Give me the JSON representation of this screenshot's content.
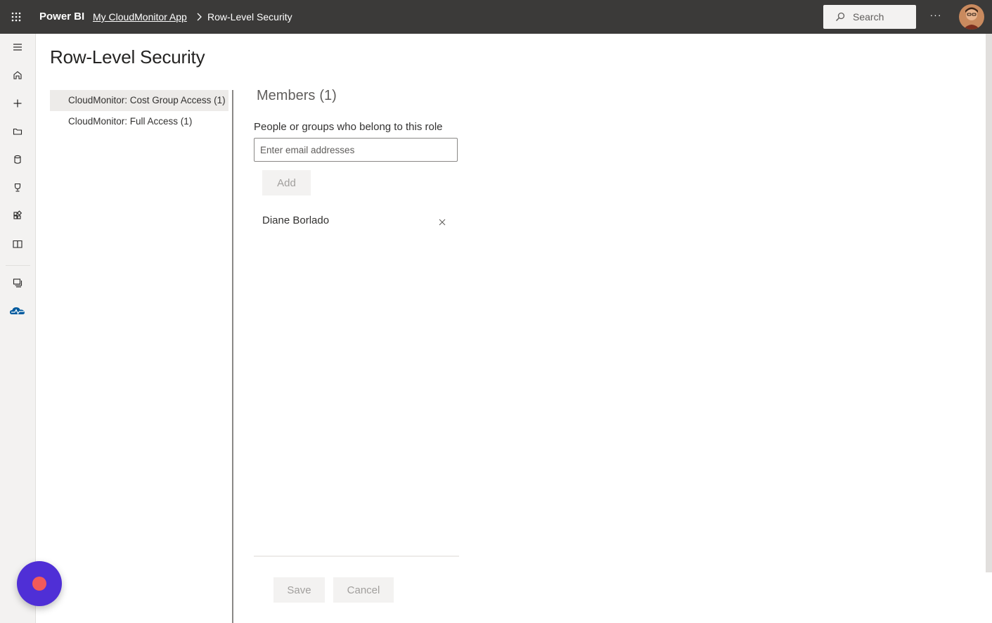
{
  "topbar": {
    "brand": "Power BI",
    "breadcrumb": {
      "app": "My CloudMonitor App",
      "current": "Row-Level Security"
    },
    "search_placeholder": "Search",
    "more_label": "···"
  },
  "rail": {
    "items": [
      {
        "name": "hamburger-icon"
      },
      {
        "name": "home-icon"
      },
      {
        "name": "plus-icon"
      },
      {
        "name": "folder-icon"
      },
      {
        "name": "database-icon"
      },
      {
        "name": "trophy-icon"
      },
      {
        "name": "apps-icon"
      },
      {
        "name": "book-icon"
      },
      {
        "name": "workspaces-icon"
      },
      {
        "name": "cloudmonitor-icon"
      }
    ],
    "accent": "#005a9e"
  },
  "page": {
    "title": "Row-Level Security"
  },
  "roles": [
    {
      "label": "CloudMonitor: Cost Group Access (1)",
      "selected": true
    },
    {
      "label": "CloudMonitor: Full Access (1)",
      "selected": false
    }
  ],
  "members": {
    "title": "Members",
    "count": "(1)",
    "field_label": "People or groups who belong to this role",
    "email_placeholder": "Enter email addresses",
    "add_label": "Add",
    "list": [
      {
        "name": "Diane Borlado"
      }
    ]
  },
  "footer": {
    "save_label": "Save",
    "cancel_label": "Cancel"
  },
  "colors": {
    "topbar": "#3b3a39",
    "fab": "#4f2fd6",
    "fab_dot": "#f25a5a"
  }
}
